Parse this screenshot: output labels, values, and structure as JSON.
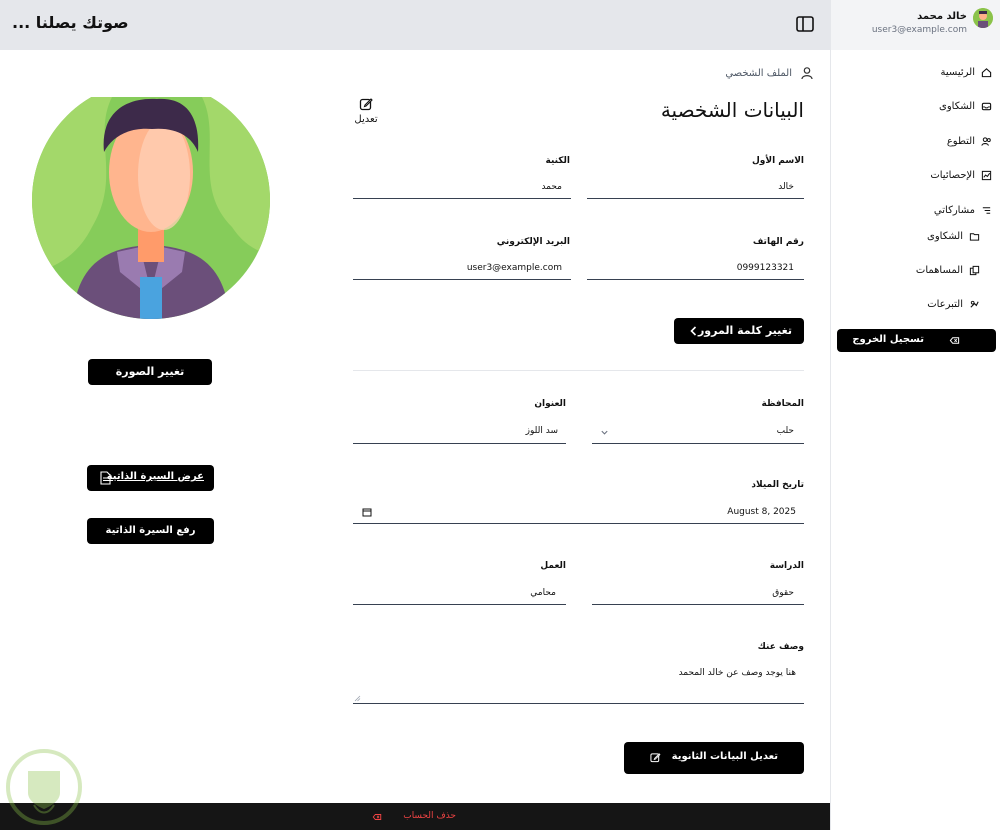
{
  "header": {
    "site_title": "صوتك يصلنا ..."
  },
  "user": {
    "name": "خالد محمد",
    "email": "user3@example.com"
  },
  "sidebar": {
    "items": [
      {
        "label": "الرئيسية",
        "icon": "home-icon"
      },
      {
        "label": "الشكاوى",
        "icon": "inbox-icon"
      },
      {
        "label": "التطوع",
        "icon": "users-icon"
      },
      {
        "label": "الإحصائيات",
        "icon": "chart-icon"
      },
      {
        "label": "مشاركاتي",
        "icon": "list-icon"
      },
      {
        "label": "الشكاوى",
        "icon": "folder-icon"
      },
      {
        "label": "المساهمات",
        "icon": "copy-icon"
      },
      {
        "label": "التبرعات",
        "icon": "donate-icon"
      }
    ],
    "logout_label": "تسجيل الخروج"
  },
  "main": {
    "breadcrumb": "الملف الشخصي",
    "title": "البيانات الشخصية",
    "edit_label": "تعديل",
    "fields": {
      "first_name_label": "الاسم الأول",
      "first_name_value": "خالد",
      "last_name_label": "الكنية",
      "last_name_value": "محمد",
      "phone_label": "رقم الهاتف",
      "phone_value": "0999123321",
      "email_label": "البريد الإلكتروني",
      "email_value": "user3@example.com",
      "governorate_label": "المحافظة",
      "governorate_value": "حلب",
      "address_label": "العنوان",
      "address_value": "سد اللوز",
      "birthdate_label": "تاريخ الميلاد",
      "birthdate_value": "August 8, 2025",
      "study_label": "الدراسة",
      "study_value": "حقوق",
      "job_label": "العمل",
      "job_value": "محامي",
      "about_label": "وصف عنك",
      "about_value": "هنا يوجد وصف عن خالد المحمد"
    },
    "change_password_label": "تغيير كلمة المرور",
    "edit_secondary_label": "تعديل البيانات الثانوية",
    "change_photo_label": "تغيير الصورة",
    "view_cv_label": "عرض السيرة الذاتية",
    "upload_cv_label": "رفع السيرة الذاتية"
  },
  "footer": {
    "delete_account_label": "حذف الحساب"
  },
  "colors": {
    "accent": "#000000",
    "danger": "#ef4444",
    "header_bg": "#e5e7eb",
    "footer_bg": "#151515"
  }
}
